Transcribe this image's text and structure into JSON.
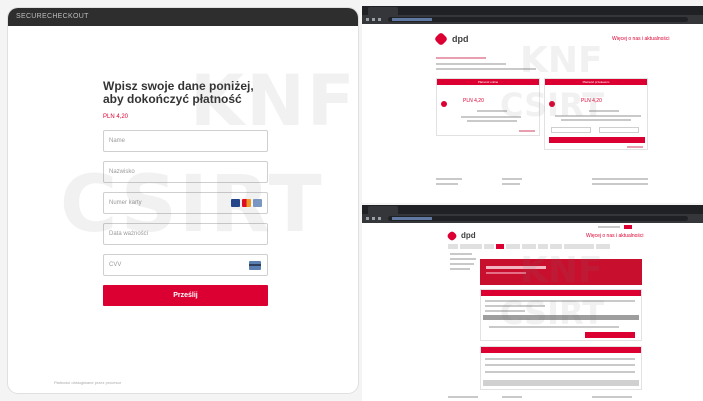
{
  "left_panel": {
    "top_label": "SECURECHECKOUT",
    "heading": "Wpisz swoje dane poniżej, aby dokończyć płatność",
    "amount": "PLN 4,20",
    "fields": {
      "first_name": "Name",
      "last_name": "Nazwisko",
      "card_number": "Numer karty",
      "expiry": "Data ważności",
      "cvv": "CVV"
    },
    "submit_label": "Prześlij",
    "footer": "Płatności obsługiwane przez procesor"
  },
  "right_top": {
    "logo_text": "dpd",
    "header_link": "Więcej o nas i aktualności",
    "panel_left_title": "Płatność online",
    "panel_right_title": "Płatność przelewem",
    "panel_left_amount": "PLN 4,20",
    "panel_right_amount": "PLN 4,20"
  },
  "right_bottom": {
    "logo_text": "dpd",
    "header_link": "Więcej o nas i aktualności"
  },
  "watermark": {
    "line1": "KNF",
    "line2": "CSIRT"
  },
  "colors": {
    "brand_red": "#dc0032",
    "dark_bar": "#202124"
  }
}
